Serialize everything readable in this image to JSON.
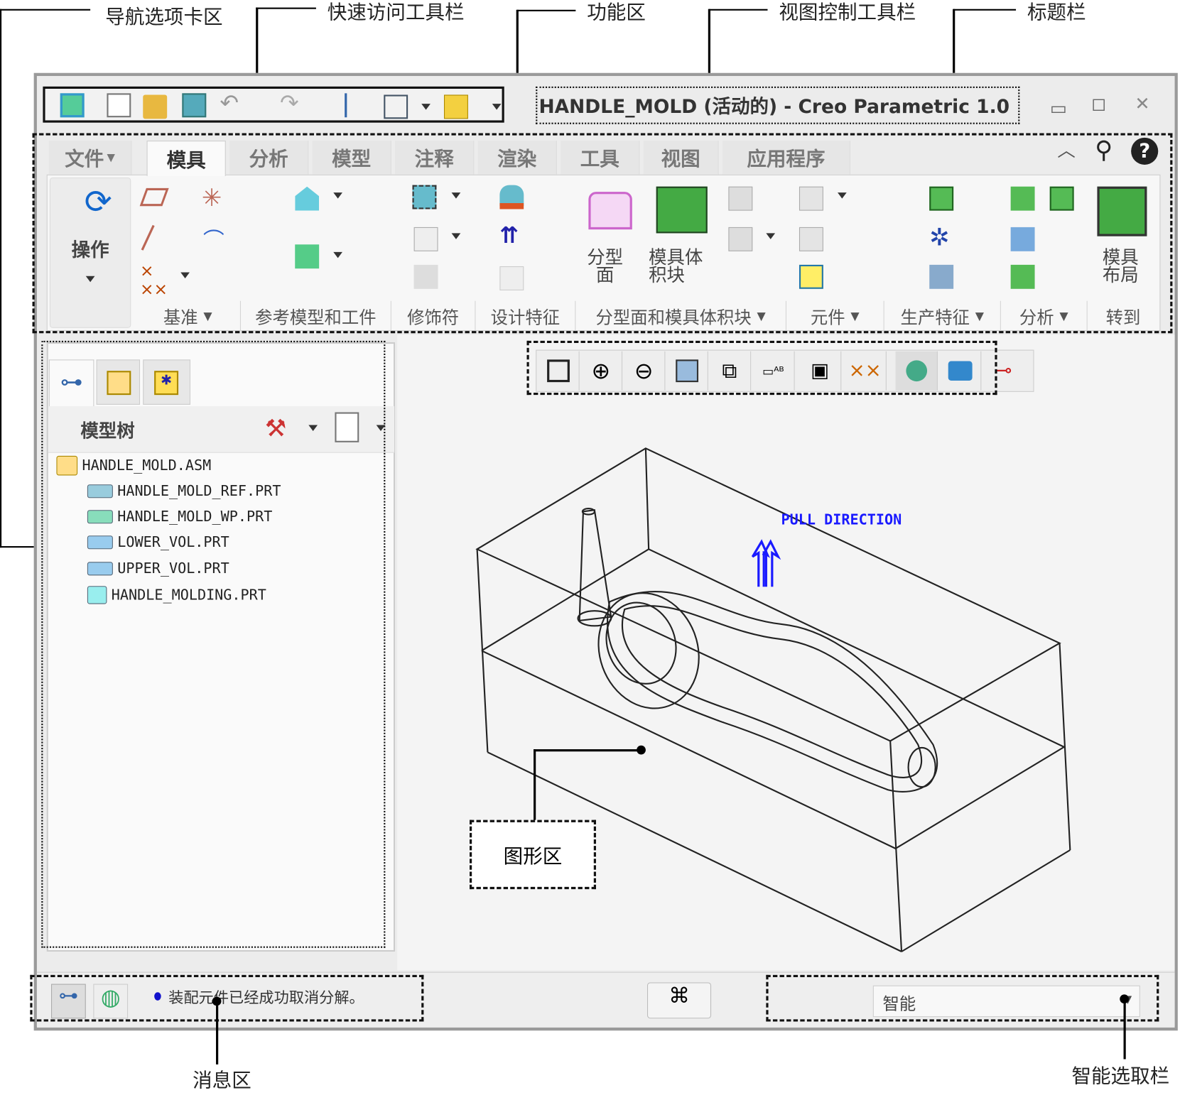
{
  "callouts": {
    "nav_tabs": "导航选项卡区",
    "quick_access": "快速访问工具栏",
    "ribbon": "功能区",
    "view_toolbar": "视图控制工具栏",
    "title_bar": "标题栏",
    "graphics": "图形区",
    "message": "消息区",
    "smart_select": "智能选取栏"
  },
  "title": "HANDLE_MOLD (活动的) - Creo Parametric 1.0",
  "tabs": [
    "文件",
    "模具",
    "分析",
    "模型",
    "注释",
    "渲染",
    "工具",
    "视图",
    "应用程序"
  ],
  "active_tab": "模具",
  "ribbon": {
    "operations_label": "操作",
    "groups": [
      "基准",
      "参考模型和工件",
      "修饰符",
      "设计特征",
      "分型面和模具体积块",
      "元件",
      "生产特征",
      "分析",
      "转到"
    ],
    "parting_surface": "分型\n面",
    "mold_volume": "模具体\n积块",
    "mold_layout": "模具\n布局"
  },
  "model_tree": {
    "title": "模型树",
    "items": [
      "HANDLE_MOLD.ASM",
      "HANDLE_MOLD_REF.PRT",
      "HANDLE_MOLD_WP.PRT",
      "LOWER_VOL.PRT",
      "UPPER_VOL.PRT",
      "HANDLE_MOLDING.PRT"
    ]
  },
  "graphics": {
    "annotation": "PULL DIRECTION"
  },
  "status": {
    "message": "装配元件已经成功取消分解。",
    "filter_value": "智能"
  },
  "colors": {
    "window_bg": "#ececec",
    "accent_blue": "#1a1aff"
  }
}
